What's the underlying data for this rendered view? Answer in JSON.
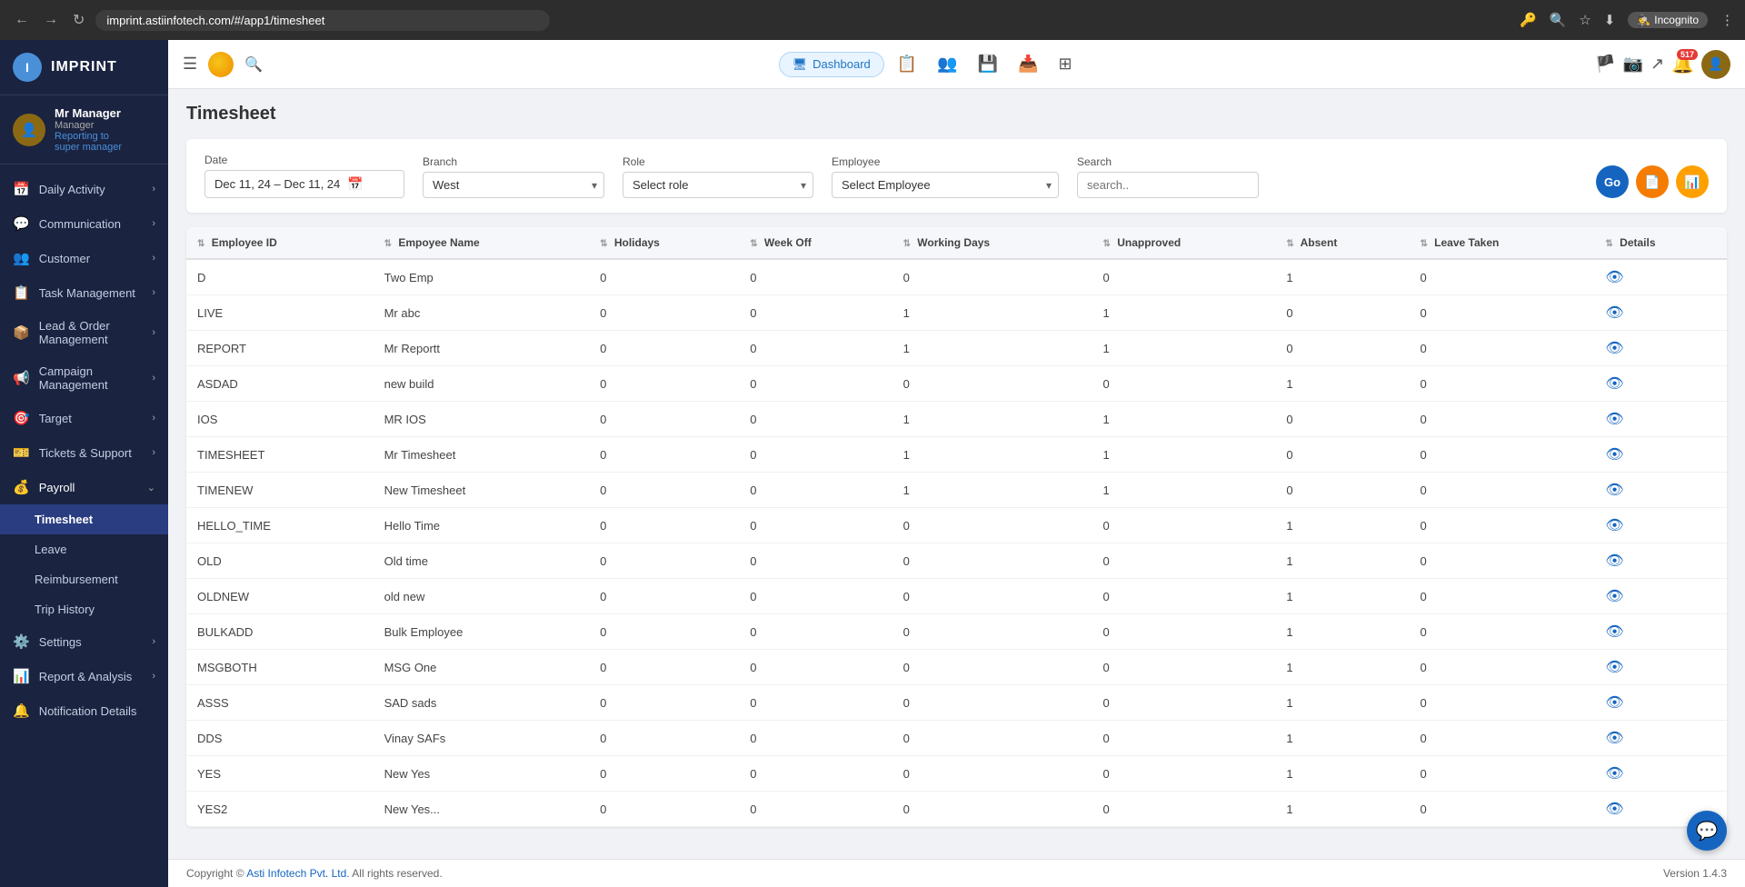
{
  "browser": {
    "url": "imprint.astiinfotech.com/#/app1/timesheet",
    "incognito_label": "Incognito"
  },
  "sidebar": {
    "logo": "IMPRINT",
    "user": {
      "name": "Mr Manager",
      "role": "Manager",
      "reporting": "Reporting to",
      "super": "super manager"
    },
    "nav_items": [
      {
        "id": "daily-activity",
        "label": "Daily Activity",
        "icon": "📅",
        "has_sub": true
      },
      {
        "id": "communication",
        "label": "Communication",
        "icon": "💬",
        "has_sub": true
      },
      {
        "id": "customer",
        "label": "Customer",
        "icon": "👥",
        "has_sub": true
      },
      {
        "id": "task-management",
        "label": "Task Management",
        "icon": "📋",
        "has_sub": true
      },
      {
        "id": "lead-order-management",
        "label": "Lead & Order Management",
        "icon": "📦",
        "has_sub": true
      },
      {
        "id": "campaign-management",
        "label": "Campaign Management",
        "icon": "📢",
        "has_sub": true
      },
      {
        "id": "target",
        "label": "Target",
        "icon": "🎯",
        "has_sub": true
      },
      {
        "id": "tickets-support",
        "label": "Tickets & Support",
        "icon": "🎫",
        "has_sub": true
      },
      {
        "id": "payroll",
        "label": "Payroll",
        "icon": "💰",
        "has_sub": true,
        "expanded": true
      }
    ],
    "payroll_sub": [
      {
        "id": "timesheet",
        "label": "Timesheet",
        "active": true
      },
      {
        "id": "leave",
        "label": "Leave"
      },
      {
        "id": "reimbursement",
        "label": "Reimbursement"
      },
      {
        "id": "trip-history",
        "label": "Trip History"
      }
    ],
    "bottom_nav": [
      {
        "id": "settings",
        "label": "Settings",
        "icon": "⚙️",
        "has_sub": true
      },
      {
        "id": "report-analysis",
        "label": "Report & Analysis",
        "icon": "📊",
        "has_sub": true
      },
      {
        "id": "notification-details",
        "label": "Notification Details",
        "icon": "🔔",
        "has_sub": false
      }
    ]
  },
  "header": {
    "dashboard_label": "Dashboard",
    "notification_count": "517"
  },
  "page": {
    "title": "Timesheet",
    "filters": {
      "date_label": "Date",
      "date_value": "Dec 11, 24 – Dec 11, 24",
      "branch_label": "Branch",
      "branch_value": "West",
      "role_label": "Role",
      "role_placeholder": "Select role",
      "employee_label": "Employee",
      "employee_placeholder": "Select Employee",
      "search_label": "Search",
      "search_placeholder": "search.."
    },
    "buttons": {
      "go": "Go",
      "export_pdf": "📄",
      "export_excel": "📊"
    },
    "table": {
      "columns": [
        "Employee ID",
        "Empoyee Name",
        "Holidays",
        "Week Off",
        "Working Days",
        "Unapproved",
        "Absent",
        "Leave Taken",
        "Details"
      ],
      "rows": [
        {
          "emp_id": "D",
          "emp_name": "Two Emp",
          "holidays": "0",
          "week_off": "0",
          "working_days": "0",
          "unapproved": "0",
          "absent": "1",
          "leave_taken": "0"
        },
        {
          "emp_id": "LIVE",
          "emp_name": "Mr abc",
          "holidays": "0",
          "week_off": "0",
          "working_days": "1",
          "unapproved": "1",
          "absent": "0",
          "leave_taken": "0"
        },
        {
          "emp_id": "REPORT",
          "emp_name": "Mr Reportt",
          "holidays": "0",
          "week_off": "0",
          "working_days": "1",
          "unapproved": "1",
          "absent": "0",
          "leave_taken": "0"
        },
        {
          "emp_id": "ASDAD",
          "emp_name": "new build",
          "holidays": "0",
          "week_off": "0",
          "working_days": "0",
          "unapproved": "0",
          "absent": "1",
          "leave_taken": "0"
        },
        {
          "emp_id": "IOS",
          "emp_name": "MR IOS",
          "holidays": "0",
          "week_off": "0",
          "working_days": "1",
          "unapproved": "1",
          "absent": "0",
          "leave_taken": "0"
        },
        {
          "emp_id": "TIMESHEET",
          "emp_name": "Mr Timesheet",
          "holidays": "0",
          "week_off": "0",
          "working_days": "1",
          "unapproved": "1",
          "absent": "0",
          "leave_taken": "0"
        },
        {
          "emp_id": "TIMENEW",
          "emp_name": "New Timesheet",
          "holidays": "0",
          "week_off": "0",
          "working_days": "1",
          "unapproved": "1",
          "absent": "0",
          "leave_taken": "0"
        },
        {
          "emp_id": "HELLO_TIME",
          "emp_name": "Hello Time",
          "holidays": "0",
          "week_off": "0",
          "working_days": "0",
          "unapproved": "0",
          "absent": "1",
          "leave_taken": "0"
        },
        {
          "emp_id": "OLD",
          "emp_name": "Old time",
          "holidays": "0",
          "week_off": "0",
          "working_days": "0",
          "unapproved": "0",
          "absent": "1",
          "leave_taken": "0"
        },
        {
          "emp_id": "OLDNEW",
          "emp_name": "old new",
          "holidays": "0",
          "week_off": "0",
          "working_days": "0",
          "unapproved": "0",
          "absent": "1",
          "leave_taken": "0"
        },
        {
          "emp_id": "BULKADD",
          "emp_name": "Bulk Employee",
          "holidays": "0",
          "week_off": "0",
          "working_days": "0",
          "unapproved": "0",
          "absent": "1",
          "leave_taken": "0"
        },
        {
          "emp_id": "MSGBOTH",
          "emp_name": "MSG One",
          "holidays": "0",
          "week_off": "0",
          "working_days": "0",
          "unapproved": "0",
          "absent": "1",
          "leave_taken": "0"
        },
        {
          "emp_id": "ASSS",
          "emp_name": "SAD sads",
          "holidays": "0",
          "week_off": "0",
          "working_days": "0",
          "unapproved": "0",
          "absent": "1",
          "leave_taken": "0"
        },
        {
          "emp_id": "DDS",
          "emp_name": "Vinay SAFs",
          "holidays": "0",
          "week_off": "0",
          "working_days": "0",
          "unapproved": "0",
          "absent": "1",
          "leave_taken": "0"
        },
        {
          "emp_id": "YES",
          "emp_name": "New Yes",
          "holidays": "0",
          "week_off": "0",
          "working_days": "0",
          "unapproved": "0",
          "absent": "1",
          "leave_taken": "0"
        },
        {
          "emp_id": "YES2",
          "emp_name": "New Yes...",
          "holidays": "0",
          "week_off": "0",
          "working_days": "0",
          "unapproved": "0",
          "absent": "1",
          "leave_taken": "0"
        }
      ]
    }
  },
  "footer": {
    "copyright": "Copyright © ",
    "company": "Asti Infotech Pvt. Ltd.",
    "rights": " All rights reserved.",
    "version": "Version 1.4.3"
  }
}
